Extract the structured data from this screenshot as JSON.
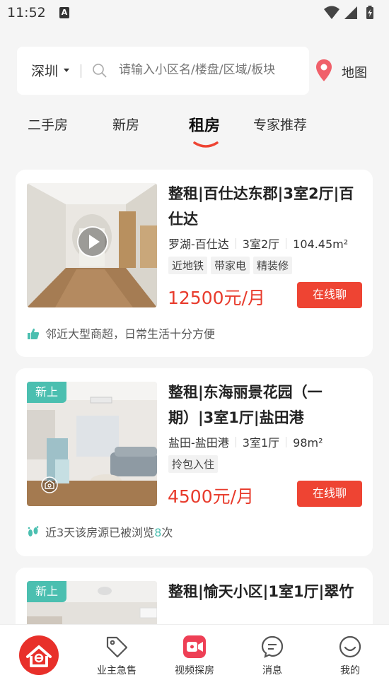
{
  "status": {
    "time": "11:52",
    "a_icon": "A"
  },
  "search": {
    "city": "深圳",
    "placeholder": "请输入小区名/楼盘/区域/板块",
    "map_label": "地图"
  },
  "tabs": [
    {
      "label": "二手房"
    },
    {
      "label": "新房"
    },
    {
      "label": "租房",
      "active": true
    },
    {
      "label": "专家推荐"
    }
  ],
  "listings": [
    {
      "title": "整租|百仕达东郡|3室2厅|百仕达",
      "district": "罗湖-百仕达",
      "layout": "3室2厅",
      "area": "104.45m²",
      "tags": [
        "近地铁",
        "带家电",
        "精装修"
      ],
      "price": "12500元/月",
      "chat": "在线聊",
      "footer": "邻近大型商超，日常生活十分方便",
      "footer_icon": "thumbs-up-icon",
      "badge": "",
      "media": "video"
    },
    {
      "title": "整租|东海丽景花园（一期）|3室1厅|盐田港",
      "district": "盐田-盐田港",
      "layout": "3室1厅",
      "area": "98m²",
      "tags": [
        "拎包入住"
      ],
      "price": "4500元/月",
      "chat": "在线聊",
      "footer_prefix": "近3天该房源已被浏览",
      "footer_count": "8",
      "footer_suffix": "次",
      "footer_icon": "footprints-icon",
      "badge": "新上",
      "media": "vr"
    },
    {
      "title": "整租|愉天小区|1室1厅|翠竹",
      "badge": "新上"
    }
  ],
  "nav": [
    {
      "label": "",
      "icon": "home-logo-icon"
    },
    {
      "label": "业主急售",
      "icon": "tag-icon"
    },
    {
      "label": "视频探房",
      "icon": "video-camera-icon"
    },
    {
      "label": "消息",
      "icon": "message-icon"
    },
    {
      "label": "我的",
      "icon": "smile-face-icon"
    }
  ],
  "colors": {
    "accent": "#ee4433",
    "price": "#e83b2c",
    "teal": "#4bbfb0"
  }
}
